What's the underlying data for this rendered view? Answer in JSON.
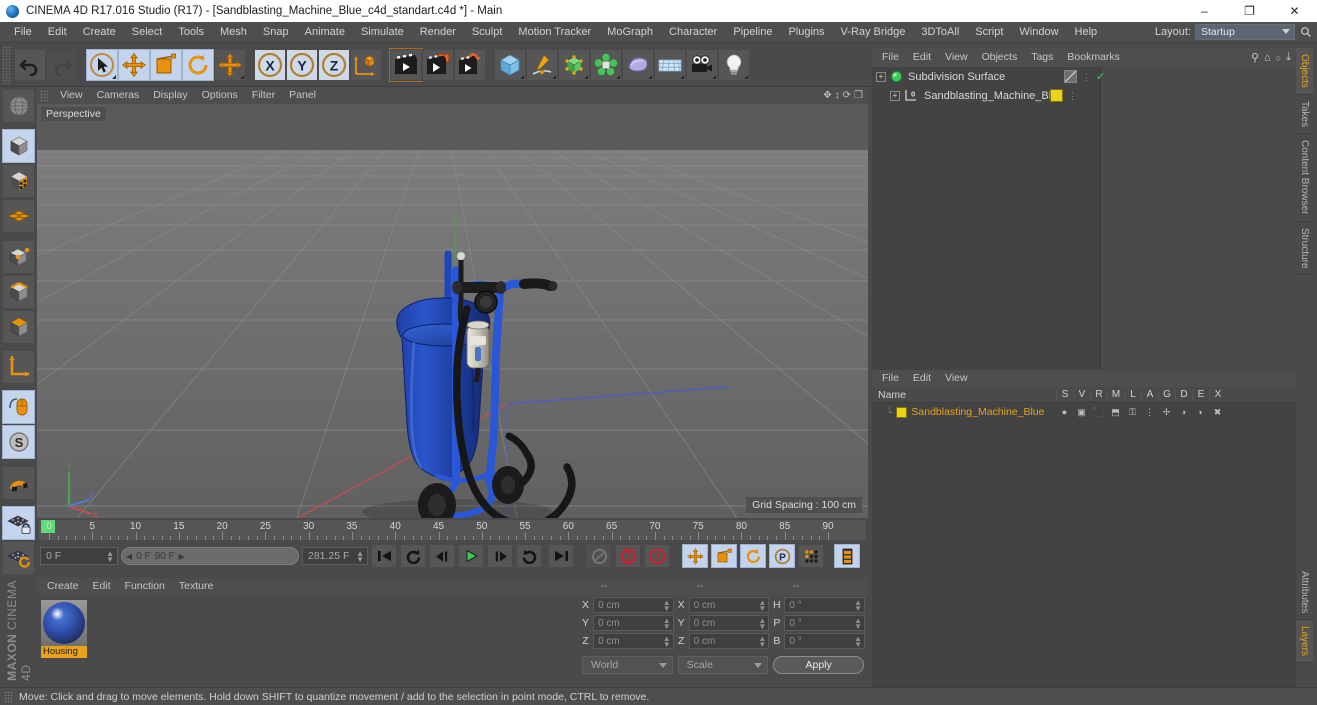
{
  "titlebar": {
    "title": "CINEMA 4D R17.016 Studio (R17) - [Sandblasting_Machine_Blue_c4d_standart.c4d *] - Main",
    "logo_icon": "c4d-logo-icon",
    "minimize": "–",
    "maximize": "❐",
    "close": "✕"
  },
  "menubar": {
    "items": [
      "File",
      "Edit",
      "Create",
      "Select",
      "Tools",
      "Mesh",
      "Snap",
      "Animate",
      "Simulate",
      "Render",
      "Sculpt",
      "Motion Tracker",
      "MoGraph",
      "Character",
      "Pipeline",
      "Plugins",
      "V-Ray Bridge",
      "3DToAll",
      "Script",
      "Window",
      "Help"
    ],
    "layout_label": "Layout:",
    "layout_value": "Startup",
    "search_icon": "search-icon"
  },
  "toolbar": {
    "groups": [
      {
        "name": "history",
        "buttons": [
          {
            "name": "undo-button",
            "icon": "undo-arrow-icon",
            "state": "normal"
          },
          {
            "name": "redo-button",
            "icon": "redo-arrow-icon",
            "state": "disabled"
          }
        ]
      },
      {
        "name": "transform",
        "buttons": [
          {
            "name": "select-tool-button",
            "icon": "cursor-select-icon",
            "state": "active"
          },
          {
            "name": "move-tool-button",
            "icon": "move-cross-icon",
            "state": "active"
          },
          {
            "name": "scale-tool-button",
            "icon": "scale-icon",
            "state": "active"
          },
          {
            "name": "rotate-tool-button",
            "icon": "rotate-icon",
            "state": "active"
          },
          {
            "name": "move-axis-button",
            "icon": "move-cross-icon",
            "state": "normal"
          }
        ]
      },
      {
        "name": "axis-lock",
        "buttons": [
          {
            "name": "axis-x-button",
            "icon": "x-axis-icon",
            "label": "X",
            "state": "active"
          },
          {
            "name": "axis-y-button",
            "icon": "y-axis-icon",
            "label": "Y",
            "state": "active"
          },
          {
            "name": "axis-z-button",
            "icon": "z-axis-icon",
            "label": "Z",
            "state": "active"
          },
          {
            "name": "world-coordinate-button",
            "icon": "world-axis-cube-icon",
            "state": "normal"
          }
        ]
      },
      {
        "name": "render",
        "buttons": [
          {
            "name": "render-view-button",
            "icon": "clapperboard-icon",
            "state": "normal"
          },
          {
            "name": "render-to-picture-viewer-button",
            "icon": "clapperboard-window-icon",
            "state": "normal"
          },
          {
            "name": "render-settings-button",
            "icon": "clapperboard-gear-icon",
            "state": "normal"
          }
        ]
      },
      {
        "name": "create",
        "buttons": [
          {
            "name": "add-cube-button",
            "icon": "blue-cube-icon",
            "state": "normal"
          },
          {
            "name": "add-spline-button",
            "icon": "pen-spline-icon",
            "state": "normal"
          },
          {
            "name": "add-nurbs-button",
            "icon": "green-cube-nurbs-icon",
            "state": "normal"
          },
          {
            "name": "add-array-button",
            "icon": "green-cluster-icon",
            "state": "normal"
          },
          {
            "name": "add-deformer-button",
            "icon": "purple-deformer-icon",
            "state": "normal"
          },
          {
            "name": "add-scene-button",
            "icon": "floor-grid-icon",
            "state": "normal"
          },
          {
            "name": "add-camera-button",
            "icon": "camera-icon",
            "state": "normal"
          },
          {
            "name": "add-light-button",
            "icon": "light-bulb-icon",
            "state": "normal"
          }
        ]
      }
    ]
  },
  "leftrail": {
    "buttons": [
      {
        "name": "make-editable-button",
        "icon": "globe-wire-icon",
        "state": "normal"
      },
      {
        "name": "model-mode-button",
        "icon": "model-cube-icon",
        "state": "active"
      },
      {
        "name": "texture-mode-button",
        "icon": "texture-checker-cube-icon",
        "state": "normal"
      },
      {
        "name": "workplane-mode-button",
        "icon": "orange-grid-icon",
        "state": "normal"
      },
      {
        "name": "point-mode-button",
        "icon": "point-cube-icon",
        "state": "normal"
      },
      {
        "name": "edge-mode-button",
        "icon": "edge-cube-icon",
        "state": "normal"
      },
      {
        "name": "polygon-mode-button",
        "icon": "polygon-cube-icon",
        "state": "normal"
      },
      {
        "name": "axis-mode-button",
        "icon": "axis-arrow-icon",
        "state": "normal"
      },
      {
        "name": "viewport-solo-button",
        "icon": "mouse-icon",
        "state": "active"
      },
      {
        "name": "snap-toggle-button",
        "icon": "snap-s-icon",
        "state": "active"
      },
      {
        "name": "magnet-button",
        "icon": "magnet-icon",
        "state": "normal"
      },
      {
        "name": "lock-workplane-button",
        "icon": "grid-lock-icon",
        "state": "active"
      },
      {
        "name": "rotate-workplane-button",
        "icon": "grid-rotate-icon",
        "state": "normal"
      }
    ],
    "brand_top": "MAXON",
    "brand_bottom": "CINEMA 4D"
  },
  "viewport": {
    "menu": [
      "View",
      "Cameras",
      "Display",
      "Options",
      "Filter",
      "Panel"
    ],
    "grip_icon": "drag-grip-icon",
    "nav_icons": [
      {
        "name": "pan-view-icon",
        "glyph": "✥"
      },
      {
        "name": "dolly-view-icon",
        "glyph": "↕"
      },
      {
        "name": "rotate-view-icon",
        "glyph": "⟳"
      },
      {
        "name": "maximize-view-icon",
        "glyph": "❐"
      }
    ],
    "label": "Perspective",
    "grid_spacing": "Grid Spacing : 100 cm",
    "axis_gizmo": {
      "x_label": "X",
      "y_label": "Y",
      "z_label": "Z",
      "x_color": "#d05050",
      "y_color": "#5ab85a",
      "z_color": "#5a78d0"
    },
    "scene_object": "Sandblasting machine (blue pressure tank on wheeled cart with black hose)"
  },
  "timeline": {
    "ticks": [
      0,
      5,
      10,
      15,
      20,
      25,
      30,
      35,
      40,
      45,
      50,
      55,
      60,
      65,
      70,
      75,
      80,
      85,
      90
    ],
    "playhead_frame": "0",
    "current_frame_field": "0 F",
    "range_start": "0 F",
    "range_end": "90 F",
    "end_frame_field": "281.25 F",
    "right_frame_field": "0 F",
    "range_prev_icon": "◀",
    "range_next_icon": "▶",
    "controls": [
      {
        "name": "goto-start-button",
        "icon": "skip-start-icon",
        "glyph": "⏮"
      },
      {
        "name": "play-reverse-button",
        "icon": "loop-reverse-icon",
        "glyph": "↺"
      },
      {
        "name": "step-back-button",
        "icon": "step-back-icon",
        "glyph": "◀❘"
      },
      {
        "name": "play-button",
        "icon": "play-icon",
        "glyph": "▶"
      },
      {
        "name": "step-forward-button",
        "icon": "step-forward-icon",
        "glyph": "❘▶"
      },
      {
        "name": "loop-button",
        "icon": "loop-icon",
        "glyph": "↻"
      },
      {
        "name": "goto-end-button",
        "icon": "skip-end-icon",
        "glyph": "⏭"
      }
    ],
    "record_controls": [
      {
        "name": "autokeying-button",
        "icon": "key-disabled-icon",
        "state": "disabled"
      },
      {
        "name": "record-keyframe-button",
        "icon": "record-red-icon",
        "state": "normal"
      },
      {
        "name": "keyframe-selection-button",
        "icon": "question-red-icon",
        "state": "normal"
      }
    ],
    "key_toggles": [
      {
        "name": "key-position-button",
        "icon": "move-cross-icon",
        "state": "on"
      },
      {
        "name": "key-scale-button",
        "icon": "scale-icon",
        "state": "on"
      },
      {
        "name": "key-rotation-button",
        "icon": "rotate-icon",
        "state": "on"
      },
      {
        "name": "key-parameter-button",
        "icon": "param-p-icon",
        "state": "on"
      },
      {
        "name": "key-pla-button",
        "icon": "point-level-anim-icon",
        "state": "normal"
      },
      {
        "name": "timeline-layout-button",
        "icon": "timeline-strip-icon",
        "state": "on"
      }
    ]
  },
  "material_manager": {
    "menu": [
      "Create",
      "Edit",
      "Function",
      "Texture"
    ],
    "materials": [
      {
        "name": "Housing",
        "swatch_color": "#2546a8"
      }
    ]
  },
  "coordinates": {
    "headers": [
      "--",
      "--",
      "--"
    ],
    "rows": [
      {
        "pos_axis": "X",
        "pos_value": "0 cm",
        "size_axis": "X",
        "size_value": "0 cm",
        "rot_axis": "H",
        "rot_value": "0 °"
      },
      {
        "pos_axis": "Y",
        "pos_value": "0 cm",
        "size_axis": "Y",
        "size_value": "0 cm",
        "rot_axis": "P",
        "rot_value": "0 °"
      },
      {
        "pos_axis": "Z",
        "pos_value": "0 cm",
        "size_axis": "Z",
        "size_value": "0 cm",
        "rot_axis": "B",
        "rot_value": "0 °"
      }
    ],
    "system_value": "World",
    "mode_value": "Scale",
    "apply_label": "Apply"
  },
  "object_manager": {
    "menu": [
      "File",
      "Edit",
      "View",
      "Objects",
      "Tags",
      "Bookmarks"
    ],
    "tools": [
      {
        "name": "search-objects-icon",
        "glyph": "⚲"
      },
      {
        "name": "home-objects-icon",
        "glyph": "⌂"
      },
      {
        "name": "link-objects-icon",
        "glyph": "○"
      },
      {
        "name": "expand-objects-icon",
        "glyph": "⤓"
      }
    ],
    "items": [
      {
        "name": "Subdivision Surface",
        "icon": "subdivision-surface-icon",
        "depth": 0,
        "tags": [
          {
            "name": "subdivision-tag",
            "icon": "grey-slash-tag-icon"
          },
          {
            "name": "dots-icon",
            "icon": "vertical-dots-icon"
          },
          {
            "name": "enabled-check-icon",
            "icon": "green-check-icon"
          }
        ]
      },
      {
        "name": "Sandblasting_Machine_Blue",
        "icon": "null-layer-l0-icon",
        "depth": 1,
        "tags": [
          {
            "name": "layer-color-tag",
            "icon": "yellow-swatch-icon"
          },
          {
            "name": "dots-icon",
            "icon": "vertical-dots-icon"
          }
        ]
      }
    ]
  },
  "layer_manager": {
    "menu": [
      "File",
      "Edit",
      "View"
    ],
    "columns": [
      "Name",
      "S",
      "V",
      "R",
      "M",
      "L",
      "A",
      "G",
      "D",
      "E",
      "X"
    ],
    "rows": [
      {
        "name": "Sandblasting_Machine_Blue",
        "swatch_color": "#e9d416",
        "cells": [
          {
            "name": "solo-cell",
            "icon": "grey-dot-icon",
            "glyph": "●"
          },
          {
            "name": "visible-cell",
            "icon": "visible-icon",
            "glyph": "▣"
          },
          {
            "name": "render-cell",
            "icon": "render-icon",
            "glyph": "⬛"
          },
          {
            "name": "manager-cell",
            "icon": "manager-icon",
            "glyph": "⬒"
          },
          {
            "name": "lock-cell",
            "icon": "lock-icon",
            "glyph": "⚿"
          },
          {
            "name": "animation-cell",
            "icon": "animation-dots-icon",
            "glyph": "⋮"
          },
          {
            "name": "generator-cell",
            "icon": "generator-icon",
            "glyph": "✢"
          },
          {
            "name": "deformer-cell",
            "icon": "deformer-icon",
            "glyph": "◑"
          },
          {
            "name": "expression-cell",
            "icon": "expression-icon",
            "glyph": "◗"
          },
          {
            "name": "xpresso-cell",
            "icon": "xpresso-icon",
            "glyph": "✖"
          }
        ]
      }
    ]
  },
  "right_tabs": {
    "top": [
      {
        "label": "Objects",
        "active": true
      },
      {
        "label": "Takes",
        "active": false
      },
      {
        "label": "Content Browser",
        "active": false
      },
      {
        "label": "Structure",
        "active": false
      }
    ],
    "bottom": [
      {
        "label": "Attributes",
        "active": false
      },
      {
        "label": "Layers",
        "active": true
      }
    ]
  },
  "statusbar": {
    "grip_icon": "drag-grip-icon",
    "text": "Move: Click and drag to move elements. Hold down SHIFT to quantize movement / add to the selection in point mode, CTRL to remove."
  }
}
